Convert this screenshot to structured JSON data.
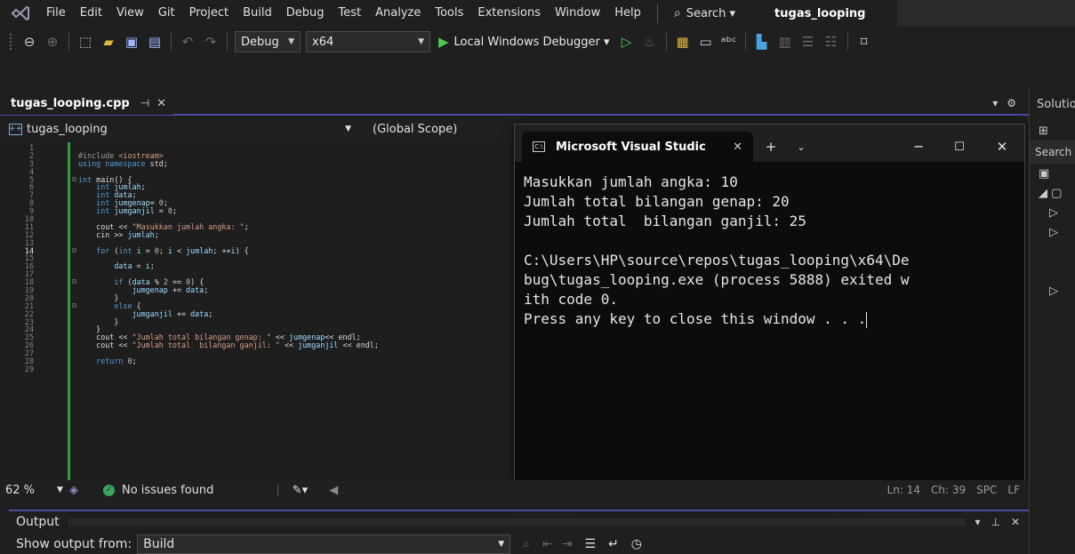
{
  "menubar": {
    "items": [
      "File",
      "Edit",
      "View",
      "Git",
      "Project",
      "Build",
      "Debug",
      "Test",
      "Analyze",
      "Tools",
      "Extensions",
      "Window",
      "Help"
    ],
    "search_label": "Search ▾",
    "title": "tugas_looping"
  },
  "toolbar": {
    "configuration": "Debug",
    "platform": "x64",
    "run_label": "Local Windows Debugger ▾"
  },
  "editor": {
    "tab_label": "tugas_looping.cpp",
    "project_label": "tugas_looping",
    "scope_label": "(Global Scope)",
    "current_line": "14"
  },
  "code_lines": [
    {
      "n": "1",
      "html": ""
    },
    {
      "n": "2",
      "html": "<span class='pre'>#include </span><span class='str'>&lt;iostream&gt;</span>"
    },
    {
      "n": "3",
      "html": "<span class='kw'>using namespace</span> std;"
    },
    {
      "n": "4",
      "html": ""
    },
    {
      "n": "5",
      "html": "<span class='kw'>int</span> main() {"
    },
    {
      "n": "6",
      "html": "    <span class='kw'>int</span> <span class='var'>jumlah</span>;"
    },
    {
      "n": "7",
      "html": "    <span class='kw'>int</span> <span class='var'>data</span>;"
    },
    {
      "n": "8",
      "html": "    <span class='kw'>int</span> <span class='var'>jumgenap</span>= <span class='num'>0</span>;"
    },
    {
      "n": "9",
      "html": "    <span class='kw'>int</span> <span class='var'>jumganjil</span> = <span class='num'>0</span>;"
    },
    {
      "n": "10",
      "html": ""
    },
    {
      "n": "11",
      "html": "    cout &lt;&lt; <span class='str'>\"Masukkan jumlah angka: \"</span>;"
    },
    {
      "n": "12",
      "html": "    cin &gt;&gt; <span class='var'>jumlah</span>;"
    },
    {
      "n": "13",
      "html": ""
    },
    {
      "n": "14",
      "html": "    <span class='kw'>for</span> (<span class='kw'>int</span> <span class='var'>i</span> = <span class='num'>0</span>; <span class='var'>i</span> &lt; <span class='var'>jumlah</span>; ++<span class='var'>i</span>) {"
    },
    {
      "n": "15",
      "html": ""
    },
    {
      "n": "16",
      "html": "        <span class='var'>data</span> = <span class='var'>i</span>;"
    },
    {
      "n": "17",
      "html": ""
    },
    {
      "n": "18",
      "html": "        <span class='kw'>if</span> (<span class='var'>data</span> % <span class='num'>2</span> == <span class='num'>0</span>) {"
    },
    {
      "n": "19",
      "html": "            <span class='var'>jumgenap</span> += <span class='var'>data</span>;"
    },
    {
      "n": "20",
      "html": "        }"
    },
    {
      "n": "21",
      "html": "        <span class='kw'>else</span> {"
    },
    {
      "n": "22",
      "html": "            <span class='var'>jumganjil</span> += <span class='var'>data</span>;"
    },
    {
      "n": "23",
      "html": "        }"
    },
    {
      "n": "24",
      "html": "    }"
    },
    {
      "n": "25",
      "html": "    cout &lt;&lt; <span class='str'>\"Jumlah total bilangan genap: \"</span> &lt;&lt; <span class='var'>jumgenap</span>&lt;&lt; endl;"
    },
    {
      "n": "26",
      "html": "    cout &lt;&lt; <span class='str'>\"Jumlah total  bilangan ganjil: \"</span> &lt;&lt; <span class='var'>jumganjil</span> &lt;&lt; endl;"
    },
    {
      "n": "27",
      "html": ""
    },
    {
      "n": "28",
      "html": "    <span class='kw'>return</span> <span class='num'>0</span>;"
    },
    {
      "n": "29",
      "html": ""
    }
  ],
  "console": {
    "title": "Microsoft Visual Studic",
    "lines": [
      "Masukkan jumlah angka: 10",
      "Jumlah total bilangan genap: 20",
      "Jumlah total  bilangan ganjil: 25",
      "",
      "C:\\Users\\HP\\source\\repos\\tugas_looping\\x64\\De",
      "bug\\tugas_looping.exe (process 5888) exited w",
      "ith code 0.",
      "Press any key to close this window . . ."
    ]
  },
  "status": {
    "zoom": "62 %",
    "issues": "No issues found",
    "ln": "Ln: 14",
    "ch": "Ch: 39",
    "spc": "SPC",
    "lf": "LF"
  },
  "output": {
    "title": "Output",
    "show_from_label": "Show output from:",
    "source": "Build"
  },
  "solution": {
    "title": "Solutio",
    "search": "Search"
  }
}
